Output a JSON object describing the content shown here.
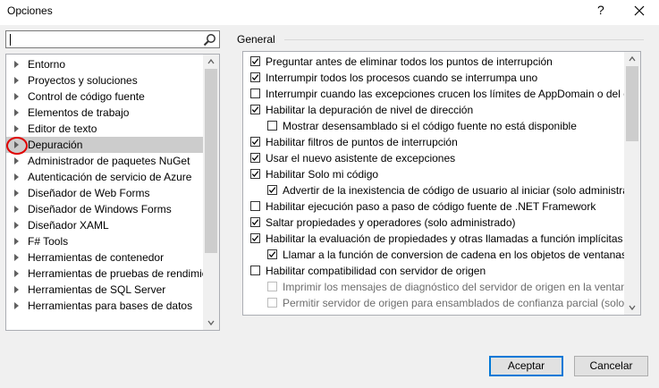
{
  "window": {
    "title": "Opciones",
    "help": "?"
  },
  "search": {
    "value": "",
    "placeholder": ""
  },
  "tree": {
    "items": [
      "Entorno",
      "Proyectos y soluciones",
      "Control de código fuente",
      "Elementos de trabajo",
      "Editor de texto",
      "Depuración",
      "Administrador de paquetes NuGet",
      "Autenticación de servicio de Azure",
      "Diseñador de Web Forms",
      "Diseñador de Windows Forms",
      "Diseñador XAML",
      "F# Tools",
      "Herramientas de contenedor",
      "Herramientas de pruebas de rendimiento",
      "Herramientas de SQL Server",
      "Herramientas para bases de datos"
    ],
    "selected_index": 5,
    "scroll_fraction": 0.0
  },
  "general": {
    "label": "General",
    "options": [
      {
        "text": "Preguntar antes de eliminar todos los puntos de interrupción",
        "checked": true,
        "indent": 0,
        "enabled": true
      },
      {
        "text": "Interrumpir todos los procesos cuando se interrumpa uno",
        "checked": true,
        "indent": 0,
        "enabled": true
      },
      {
        "text": "Interrumpir cuando las excepciones crucen los límites de AppDomain o del código administrado",
        "checked": false,
        "indent": 0,
        "enabled": true
      },
      {
        "text": "Habilitar la depuración de nivel de dirección",
        "checked": true,
        "indent": 0,
        "enabled": true
      },
      {
        "text": "Mostrar desensamblado si el código fuente no está disponible",
        "checked": false,
        "indent": 1,
        "enabled": true
      },
      {
        "text": "Habilitar filtros de puntos de interrupción",
        "checked": true,
        "indent": 0,
        "enabled": true
      },
      {
        "text": "Usar el nuevo asistente de excepciones",
        "checked": true,
        "indent": 0,
        "enabled": true
      },
      {
        "text": "Habilitar Solo mi código",
        "checked": true,
        "indent": 0,
        "enabled": true
      },
      {
        "text": "Advertir de la inexistencia de código de usuario al iniciar (solo administrado)",
        "checked": true,
        "indent": 1,
        "enabled": true
      },
      {
        "text": "Habilitar ejecución paso a paso de código fuente de .NET Framework",
        "checked": false,
        "indent": 0,
        "enabled": true
      },
      {
        "text": "Saltar propiedades y operadores (solo administrado)",
        "checked": true,
        "indent": 0,
        "enabled": true
      },
      {
        "text": "Habilitar la evaluación de propiedades y otras llamadas a función implícitas",
        "checked": true,
        "indent": 0,
        "enabled": true
      },
      {
        "text": "Llamar a la función de conversion de cadena en los objetos de ventanas de variables",
        "checked": true,
        "indent": 1,
        "enabled": true
      },
      {
        "text": "Habilitar compatibilidad con servidor de origen",
        "checked": false,
        "indent": 0,
        "enabled": true
      },
      {
        "text": "Imprimir los mensajes de diagnóstico del servidor de origen en la ventana de salida",
        "checked": false,
        "indent": 1,
        "enabled": false
      },
      {
        "text": "Permitir servidor de origen para ensamblados de confianza parcial (solo administrado)",
        "checked": false,
        "indent": 1,
        "enabled": false
      }
    ],
    "scroll_fraction": 0.0
  },
  "buttons": {
    "accept": "Aceptar",
    "cancel": "Cancelar"
  },
  "colors": {
    "selection": "#cccccc",
    "accent": "#0078d7",
    "highlight_ring": "#e00000"
  }
}
